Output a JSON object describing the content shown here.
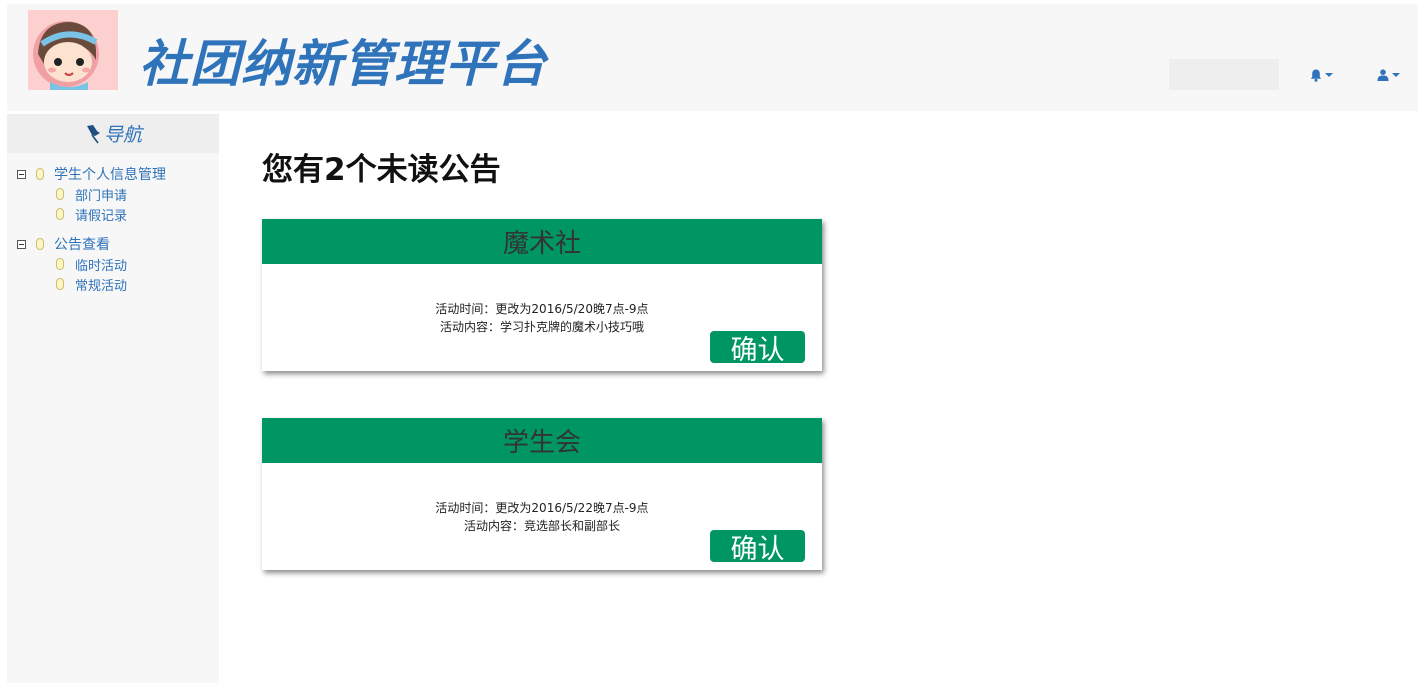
{
  "header": {
    "app_title": "社团纳新管理平台",
    "search_value": "",
    "bell_icon": "bell-icon",
    "user_icon": "user-icon",
    "accent": "#2f73ba"
  },
  "sidebar": {
    "title": "导航",
    "groups": [
      {
        "label": "学生个人信息管理",
        "children": [
          "部门申请",
          "请假记录"
        ]
      },
      {
        "label": "公告查看",
        "children": [
          "临时活动",
          "常规活动"
        ]
      }
    ]
  },
  "main": {
    "heading": "您有2个未读公告",
    "cards": [
      {
        "title": "魔术社",
        "line1": "活动时间：更改为2016/5/20晚7点-9点",
        "line2": "活动内容：学习扑克牌的魔术小技巧哦",
        "confirm": "确认"
      },
      {
        "title": "学生会",
        "line1": "活动时间：更改为2016/5/22晚7点-9点",
        "line2": "活动内容：竞选部长和副部长",
        "confirm": "确认"
      }
    ],
    "card_color": "#009663"
  }
}
